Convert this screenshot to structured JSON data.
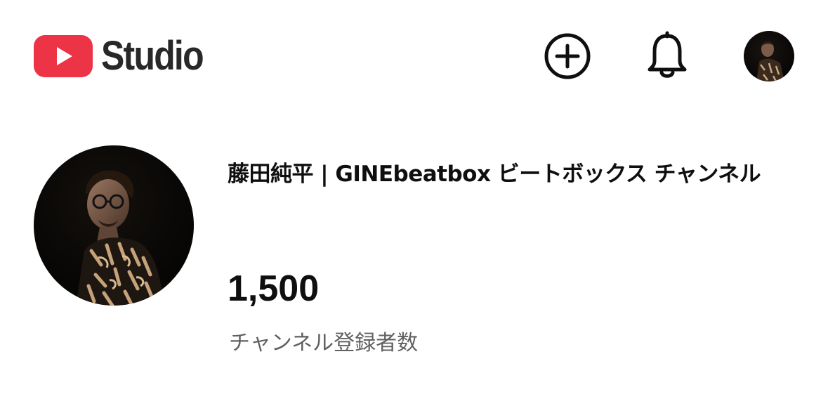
{
  "header": {
    "logo_text": "Studio",
    "create_icon": "plus-circle-icon",
    "notifications_icon": "bell-icon",
    "account_icon": "account-avatar",
    "brand_color": "#ff0000"
  },
  "channel": {
    "name": "藤田純平 | GINEbeatbox ビートボックス チャンネル",
    "subscriber_count": "1,500",
    "subscriber_label": "チャンネル登録者数"
  }
}
